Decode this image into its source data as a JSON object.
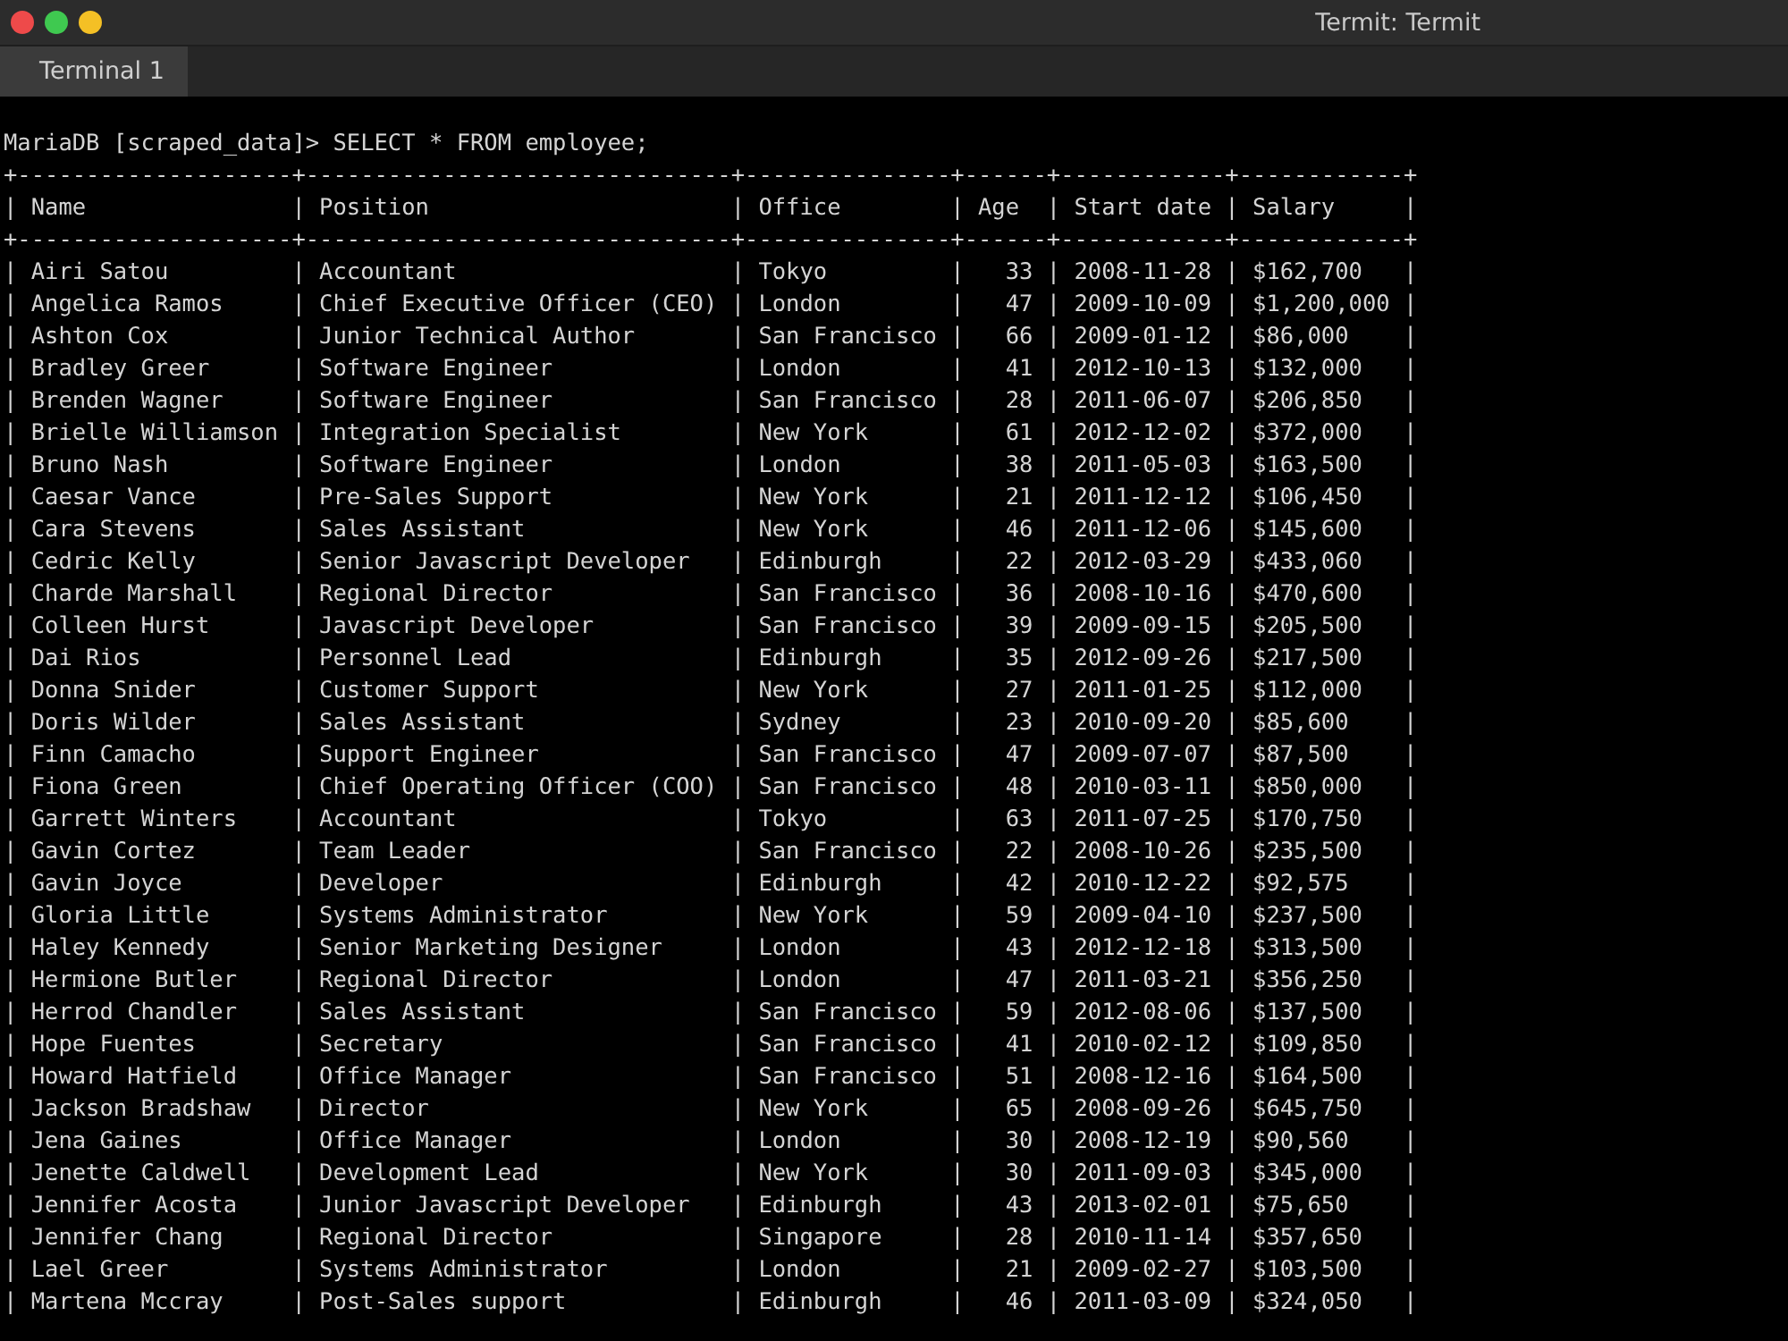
{
  "window": {
    "title": "Termit: Termit"
  },
  "tabs": [
    {
      "label": "Terminal 1",
      "selected": true
    }
  ],
  "terminal": {
    "lines": [
      "MariaDB [scraped_data]> SELECT * FROM employee;",
      "+--------------------+-------------------------------+---------------+------+------------+------------+",
      "| Name               | Position                      | Office        | Age  | Start date | Salary     |",
      "+--------------------+-------------------------------+---------------+------+------------+------------+",
      "| Airi Satou         | Accountant                    | Tokyo         |   33 | 2008-11-28 | $162,700   |",
      "| Angelica Ramos     | Chief Executive Officer (CEO) | London        |   47 | 2009-10-09 | $1,200,000 |",
      "| Ashton Cox         | Junior Technical Author       | San Francisco |   66 | 2009-01-12 | $86,000    |",
      "| Bradley Greer      | Software Engineer             | London        |   41 | 2012-10-13 | $132,000   |",
      "| Brenden Wagner     | Software Engineer             | San Francisco |   28 | 2011-06-07 | $206,850   |",
      "| Brielle Williamson | Integration Specialist        | New York      |   61 | 2012-12-02 | $372,000   |",
      "| Bruno Nash         | Software Engineer             | London        |   38 | 2011-05-03 | $163,500   |",
      "| Caesar Vance       | Pre-Sales Support             | New York      |   21 | 2011-12-12 | $106,450   |",
      "| Cara Stevens       | Sales Assistant               | New York      |   46 | 2011-12-06 | $145,600   |",
      "| Cedric Kelly       | Senior Javascript Developer   | Edinburgh     |   22 | 2012-03-29 | $433,060   |",
      "| Charde Marshall    | Regional Director             | San Francisco |   36 | 2008-10-16 | $470,600   |",
      "| Colleen Hurst      | Javascript Developer          | San Francisco |   39 | 2009-09-15 | $205,500   |",
      "| Dai Rios           | Personnel Lead                | Edinburgh     |   35 | 2012-09-26 | $217,500   |",
      "| Donna Snider       | Customer Support              | New York      |   27 | 2011-01-25 | $112,000   |",
      "| Doris Wilder       | Sales Assistant               | Sydney        |   23 | 2010-09-20 | $85,600    |",
      "| Finn Camacho       | Support Engineer              | San Francisco |   47 | 2009-07-07 | $87,500    |",
      "| Fiona Green        | Chief Operating Officer (COO) | San Francisco |   48 | 2010-03-11 | $850,000   |",
      "| Garrett Winters    | Accountant                    | Tokyo         |   63 | 2011-07-25 | $170,750   |",
      "| Gavin Cortez       | Team Leader                   | San Francisco |   22 | 2008-10-26 | $235,500   |",
      "| Gavin Joyce        | Developer                     | Edinburgh     |   42 | 2010-12-22 | $92,575    |",
      "| Gloria Little      | Systems Administrator         | New York      |   59 | 2009-04-10 | $237,500   |",
      "| Haley Kennedy      | Senior Marketing Designer     | London        |   43 | 2012-12-18 | $313,500   |",
      "| Hermione Butler    | Regional Director             | London        |   47 | 2011-03-21 | $356,250   |",
      "| Herrod Chandler    | Sales Assistant               | San Francisco |   59 | 2012-08-06 | $137,500   |",
      "| Hope Fuentes       | Secretary                     | San Francisco |   41 | 2010-02-12 | $109,850   |",
      "| Howard Hatfield    | Office Manager                | San Francisco |   51 | 2008-12-16 | $164,500   |",
      "| Jackson Bradshaw   | Director                      | New York      |   65 | 2008-09-26 | $645,750   |",
      "| Jena Gaines        | Office Manager                | London        |   30 | 2008-12-19 | $90,560    |",
      "| Jenette Caldwell   | Development Lead              | New York      |   30 | 2011-09-03 | $345,000   |",
      "| Jennifer Acosta    | Junior Javascript Developer   | Edinburgh     |   43 | 2013-02-01 | $75,650    |",
      "| Jennifer Chang     | Regional Director             | Singapore     |   28 | 2010-11-14 | $357,650   |",
      "| Lael Greer         | Systems Administrator         | London        |   21 | 2009-02-27 | $103,500   |",
      "| Martena Mccray     | Post-Sales support            | Edinburgh     |   46 | 2011-03-09 | $324,050   |"
    ]
  }
}
